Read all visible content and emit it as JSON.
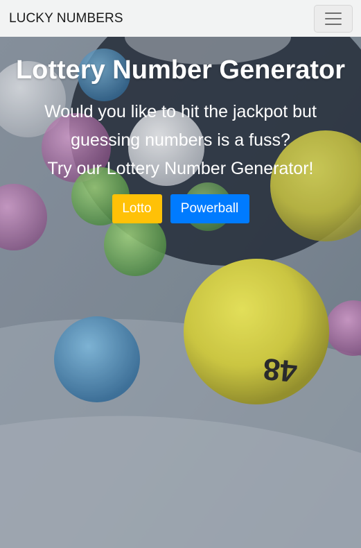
{
  "navbar": {
    "brand": "LUCKY NUMBERS"
  },
  "hero": {
    "title": "Lottery Number Generator",
    "subtitle_line1": "Would you like to hit the jackpot but guessing numbers is a fuss?",
    "subtitle_line2": "Try our Lottery Number Generator!",
    "buttons": {
      "lotto": "Lotto",
      "powerball": "Powerball"
    },
    "ball_number": "48"
  },
  "colors": {
    "lotto": "#ffc107",
    "powerball": "#007bff",
    "navbar_bg": "#f2f3f3"
  },
  "icons": [
    "hamburger-menu-icon"
  ]
}
